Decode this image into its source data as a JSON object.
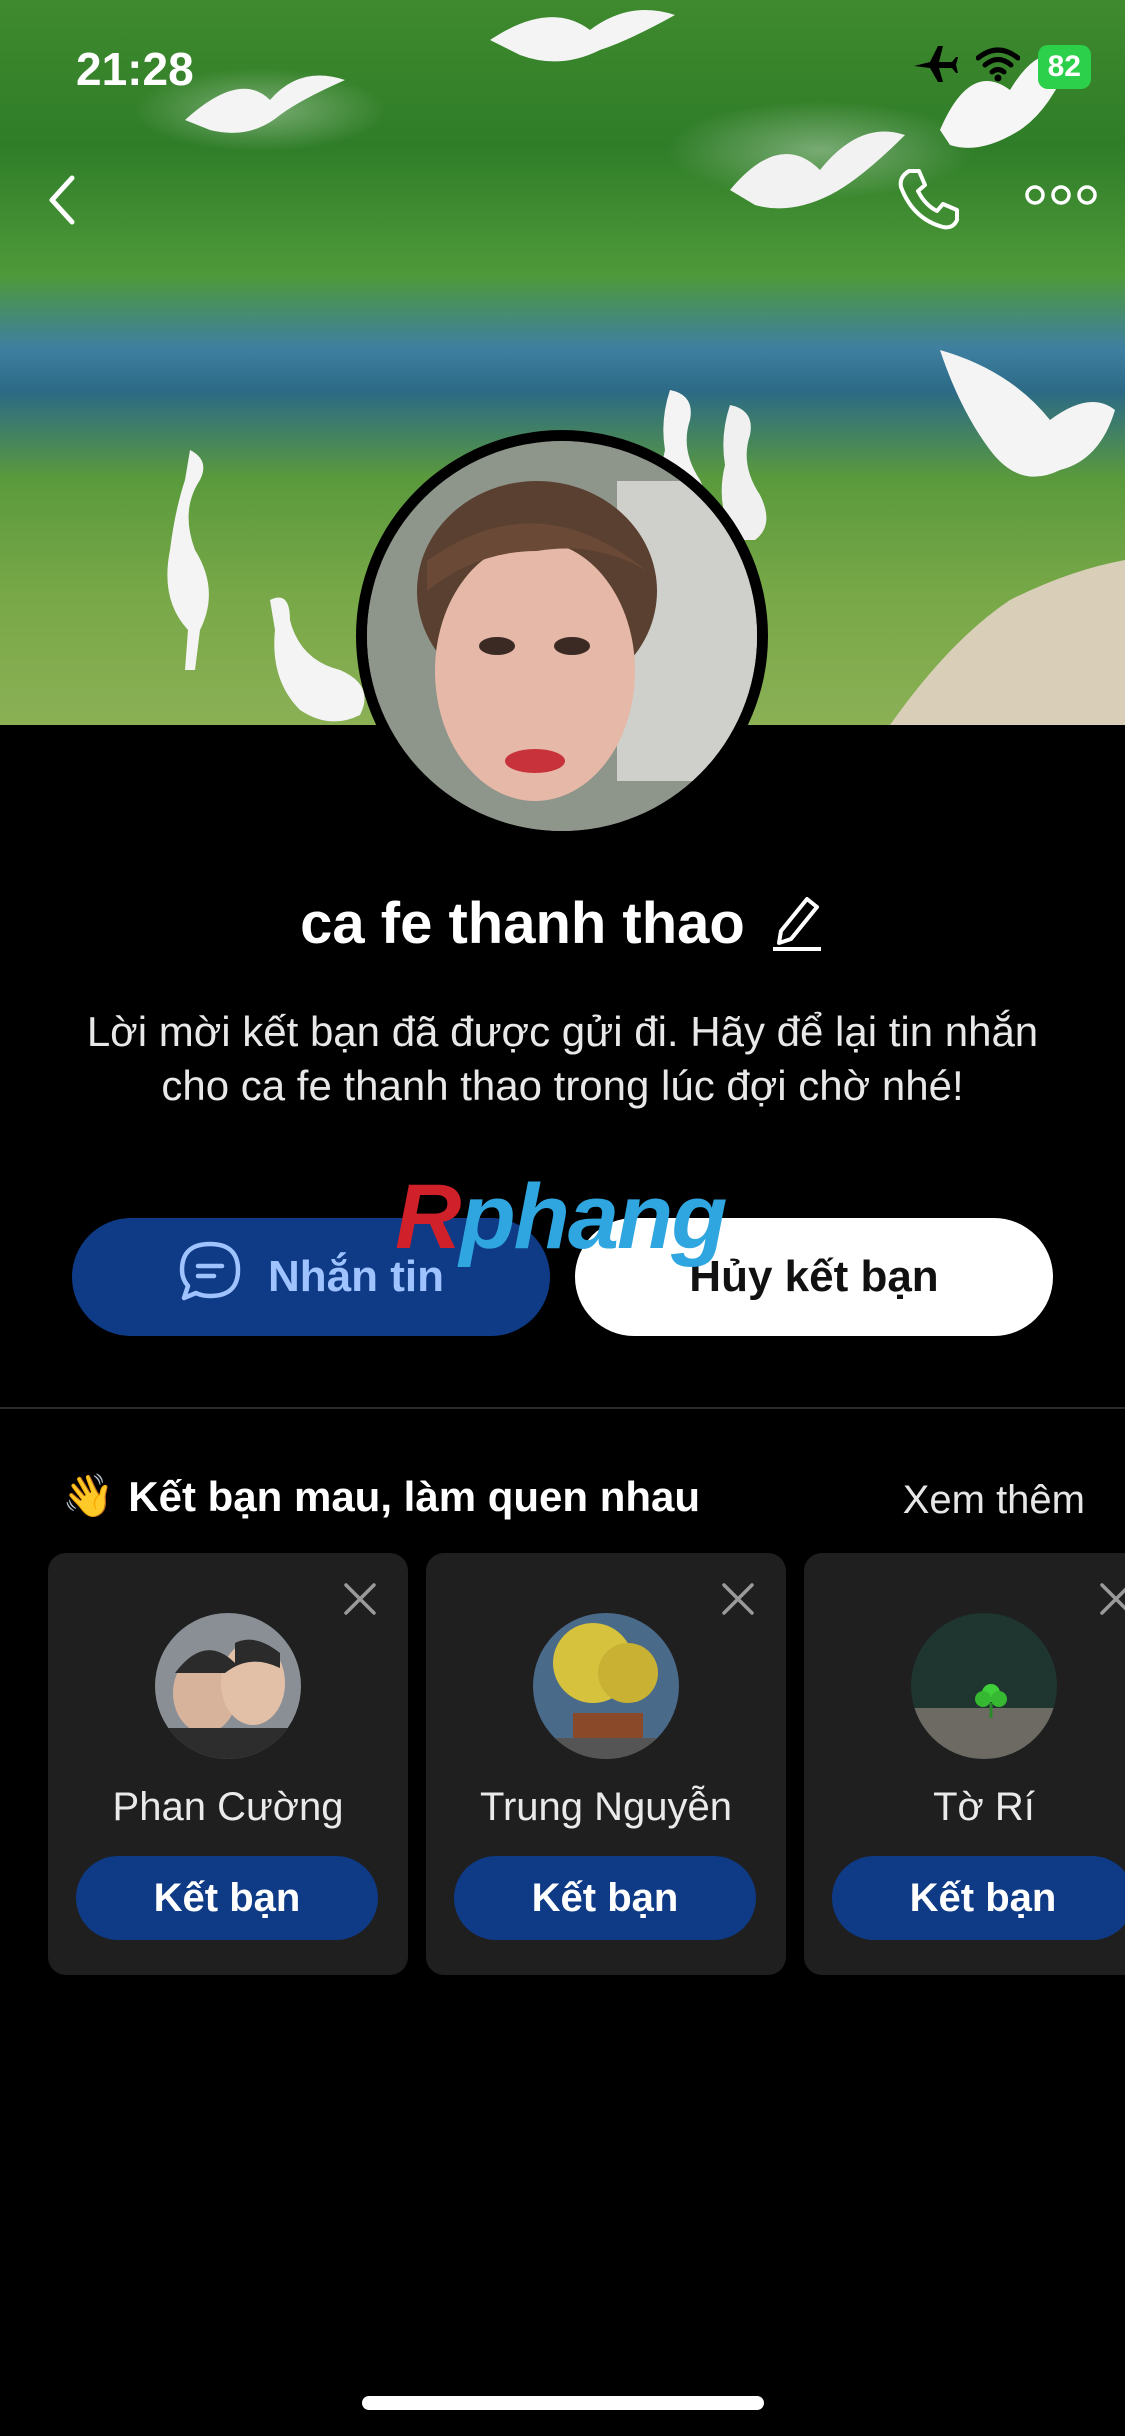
{
  "status_bar": {
    "time": "21:28",
    "battery": "82"
  },
  "profile": {
    "name": "ca fe thanh thao",
    "message": "Lời mời kết bạn đã được gửi đi. Hãy để lại tin nhắn cho ca fe thanh thao trong lúc đợi chờ nhé!"
  },
  "actions": {
    "message_label": "Nhắn tin",
    "cancel_label": "Hủy kết bạn"
  },
  "watermark": {
    "r": "R",
    "rest": "phang"
  },
  "suggestions": {
    "emoji": "👋",
    "title": "Kết bạn mau, làm quen nhau",
    "see_more": "Xem thêm",
    "people": [
      {
        "name": "Phan Cường",
        "button": "Kết bạn"
      },
      {
        "name": "Trung Nguyễn",
        "button": "Kết bạn"
      },
      {
        "name": "Tờ Rí",
        "button": "Kết bạn"
      }
    ]
  },
  "colors": {
    "primary_button": "#0e3a86",
    "battery": "#2dd04a"
  }
}
